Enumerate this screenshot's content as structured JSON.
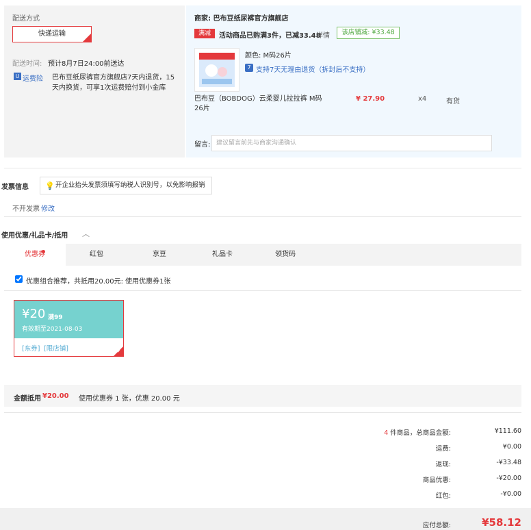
{
  "shipping": {
    "title": "配送方式",
    "method": "快递运输",
    "time_label": "配送时间:",
    "time_value": "预计8月7日24:00前送达",
    "insurance_label": "运费险",
    "insurance_desc": "巴布豆纸尿裤官方旗舰店7天内退货，15天内换货，可享1次运费赔付到小金库"
  },
  "store": {
    "name": "商家: 巴布豆纸尿裤官方旗舰店",
    "promo_tag": "满减",
    "promo_text": "活动商品已购满3件，已减33.48",
    "promo_detail": "详情",
    "shop_badge": "该店铺减: ¥33.48",
    "product": {
      "color": "颜色: M码26片",
      "return_policy": "支持7天无理由退货（拆封后不支持）",
      "name": "巴布豆（BOBDOG）云柔婴儿拉拉裤 M码26片",
      "price": "¥ 27.90",
      "quantity": "x4",
      "stock": "有货"
    },
    "remark_label": "留言:",
    "remark_placeholder": "建议留言前先与商家沟通确认"
  },
  "invoice": {
    "title": "发票信息",
    "tip": "开企业抬头发票须填写纳税人识别号，以免影响报销",
    "value": "不开发票",
    "edit": "修改"
  },
  "coupons": {
    "title": "使用优惠/礼品卡/抵用",
    "tabs": [
      "优惠券",
      "红包",
      "京豆",
      "礼品卡",
      "领货码"
    ],
    "recommend": "优惠组合推荐，共抵用20.00元: 使用优惠券1张",
    "coupon": {
      "amount": "¥20",
      "condition": "满99",
      "expire": "有效期至2021-08-03",
      "tag1": "[东券]",
      "tag2": "[限店铺]"
    },
    "deduct_label": "金额抵用",
    "deduct_amount": "¥20.00",
    "deduct_desc": "使用优惠券 1 张，优惠 20.00 元"
  },
  "summary": {
    "count": "4",
    "items_label": "件商品，总商品金额:",
    "items_value": "¥111.60",
    "freight_label": "运费:",
    "freight_value": "¥0.00",
    "cashback_label": "返现:",
    "cashback_value": "-¥33.48",
    "discount_label": "商品优惠:",
    "discount_value": "-¥20.00",
    "redpacket_label": "红包:",
    "redpacket_value": "-¥0.00",
    "total_label": "应付总额:",
    "total_value": "¥58.12"
  },
  "colors": {
    "accent": "#e4393c",
    "link": "#3a6fc4",
    "coupon": "#76d2cf"
  }
}
